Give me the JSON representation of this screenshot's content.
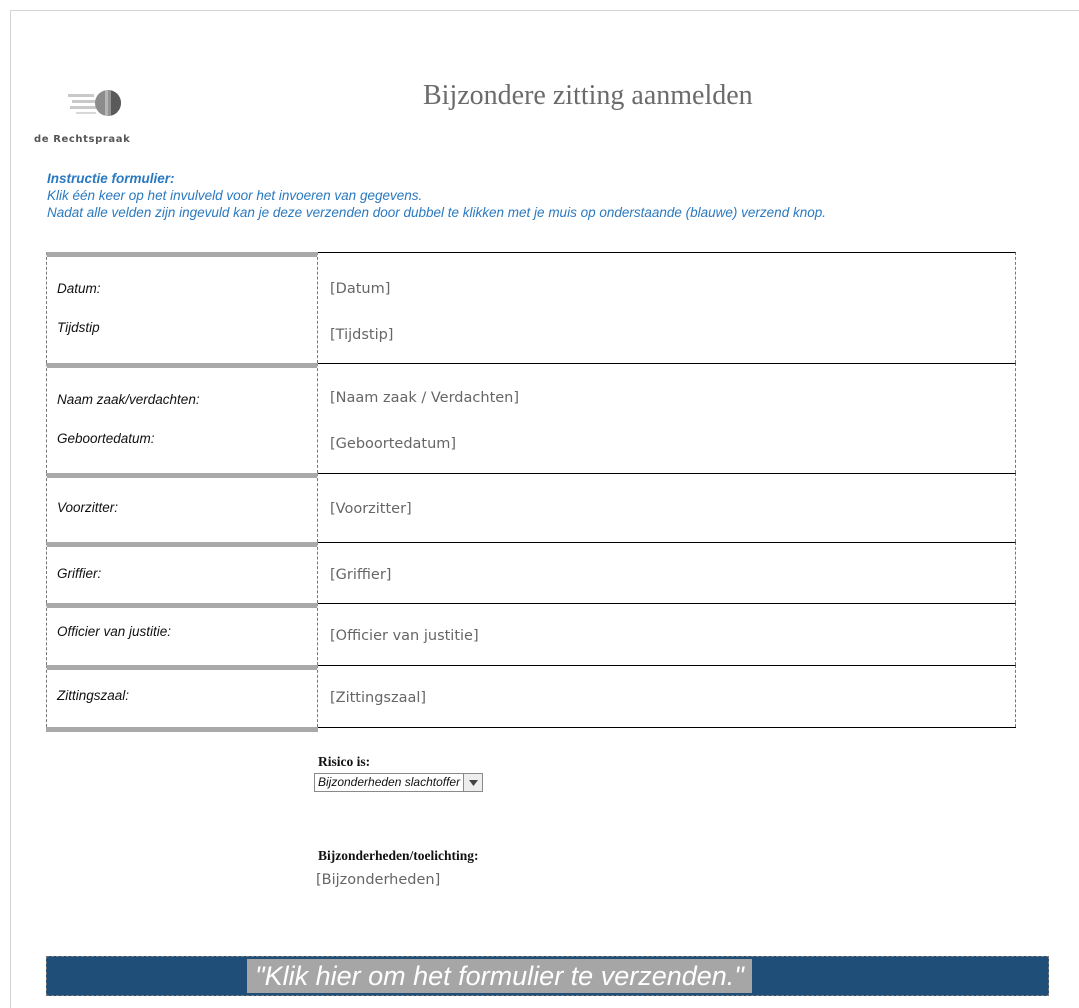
{
  "logo": {
    "text": "de Rechtspraak",
    "icon": "rechtspraak-logo-icon"
  },
  "title": "Bijzondere zitting aanmelden",
  "instructions": {
    "heading": "Instructie formulier:",
    "line1": "Klik één keer op het invulveld voor het invoeren van gegevens.",
    "line2": "Nadat alle velden zijn ingevuld kan je deze verzenden door dubbel te klikken met je muis op onderstaande (blauwe) verzend knop."
  },
  "form": {
    "datum": {
      "label": "Datum:",
      "value": "[Datum]"
    },
    "tijdstip": {
      "label": "Tijdstip",
      "value": "[Tijdstip]"
    },
    "naam": {
      "label": "Naam zaak/verdachten:",
      "value": "[Naam zaak / Verdachten]"
    },
    "geboortedatum": {
      "label": "Geboortedatum:",
      "value": "[Geboortedatum]"
    },
    "voorzitter": {
      "label": "Voorzitter:",
      "value": "[Voorzitter]"
    },
    "griffier": {
      "label": "Griffier:",
      "value": "[Griffier]"
    },
    "officier": {
      "label": "Officier van justitie:",
      "value": "[Officier van justitie]"
    },
    "zittingszaal": {
      "label": "Zittingszaal:",
      "value": "[Zittingszaal]"
    }
  },
  "risk": {
    "label": "Risico is:",
    "selected": "Bijzonderheden slachtoffer",
    "arrow_icon": "dropdown-arrow-icon"
  },
  "details": {
    "label": "Bijzonderheden/toelichting:",
    "value": "[Bijzonderheden]"
  },
  "submit": {
    "label": "\"Klik hier om het formulier te verzenden.\""
  },
  "colors": {
    "accent_blue": "#2a79c0",
    "submit_bar": "#1f4e79",
    "placeholder": "#666666"
  }
}
